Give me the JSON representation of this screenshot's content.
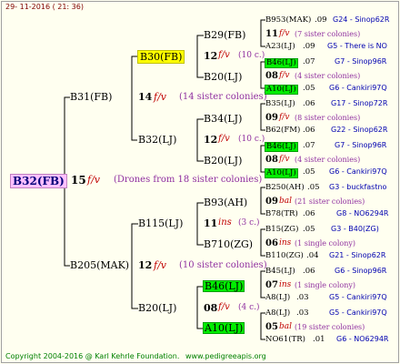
{
  "date": "29- 11-2016 ( 21: 36)",
  "footer": {
    "copyright": "Copyright 2004-2016 @ Karl Kehrle Foundation.",
    "url": "www.pedigreeapis.org"
  },
  "root": {
    "name": "B32(FB)",
    "year": "15",
    "race": "f/v",
    "note": "(Drones from 18 sister colonies)"
  },
  "g2": [
    {
      "name": "B31(FB)",
      "year": "14",
      "race": "f/v",
      "note": "(14 sister colonies)"
    },
    {
      "name": "B205(MAK)",
      "year": "12",
      "race": "f/v",
      "note": "(10 sister colonies)"
    }
  ],
  "g3": [
    {
      "name": "B30(FB)",
      "year": "12",
      "race": "f/v",
      "note": "(10 c.)"
    },
    {
      "name": "B32(LJ)",
      "year": "12",
      "race": "f/v",
      "note": "(10 c.)"
    },
    {
      "name": "B115(LJ)",
      "year": "11",
      "race": "ins",
      "note": "(3 c.)"
    },
    {
      "name": "B20(LJ)",
      "year": "08",
      "race": "f/v",
      "note": "(4 c.)"
    }
  ],
  "g4": [
    {
      "name": "B29(FB)",
      "year": "11",
      "race": "f/v",
      "note": "(7 sister colonies)"
    },
    {
      "name": "B20(LJ)",
      "year": "08",
      "race": "f/v",
      "note": "(4 sister colonies)"
    },
    {
      "name": "B34(LJ)",
      "year": "09",
      "race": "f/v",
      "note": "(8 sister colonies)"
    },
    {
      "name": "B20(LJ)",
      "year": "08",
      "race": "f/v",
      "note": "(4 sister colonies)"
    },
    {
      "name": "B93(AH)",
      "year": "09",
      "race": "bal",
      "note": "(21 sister colonies)"
    },
    {
      "name": "B710(ZG)",
      "year": "06",
      "race": "ins",
      "note": "(1 single colony)"
    },
    {
      "name": "B46(LJ)",
      "year": "07",
      "race": "ins",
      "note": "(1 single colony)"
    },
    {
      "name": "A10(LJ)",
      "year": "05",
      "race": "bal",
      "note": "(19 sister colonies)"
    }
  ],
  "g5": [
    {
      "name": "B953(MAK)",
      "yr": ".09",
      "src": "G24 - Sinop62R"
    },
    {
      "name": "A23(LJ)",
      "yr": ".09",
      "src": "G5 - There is NO"
    },
    {
      "name": "B46(LJ)",
      "yr": ".07",
      "src": "G7 - Sinop96R"
    },
    {
      "name": "A10(LJ)",
      "yr": ".05",
      "src": "G6 - Cankiri97Q"
    },
    {
      "name": "B35(LJ)",
      "yr": ".06",
      "src": "G17 - Sinop72R"
    },
    {
      "name": "B62(FM)",
      "yr": ".06",
      "src": "G22 - Sinop62R"
    },
    {
      "name": "B46(LJ)",
      "yr": ".07",
      "src": "G7 - Sinop96R"
    },
    {
      "name": "A10(LJ)",
      "yr": ".05",
      "src": "G6 - Cankiri97Q"
    },
    {
      "name": "B250(AH)",
      "yr": ".05",
      "src": "G3 - buckfastno"
    },
    {
      "name": "B78(TR)",
      "yr": ".06",
      "src": "G8 - NO6294R"
    },
    {
      "name": "B15(ZG)",
      "yr": ".05",
      "src": "G3 - B40(ZG)"
    },
    {
      "name": "B110(ZG)",
      "yr": ".04",
      "src": "G21 - Sinop62R"
    },
    {
      "name": "B45(LJ)",
      "yr": ".06",
      "src": "G6 - Sinop96R"
    },
    {
      "name": "A8(LJ)",
      "yr": ".03",
      "src": "G5 - Cankiri97Q"
    },
    {
      "name": "A8(LJ)",
      "yr": ".03",
      "src": "G5 - Cankiri97Q"
    },
    {
      "name": "NO61(TR)",
      "yr": ".01",
      "src": "G6 - NO6294R"
    }
  ]
}
